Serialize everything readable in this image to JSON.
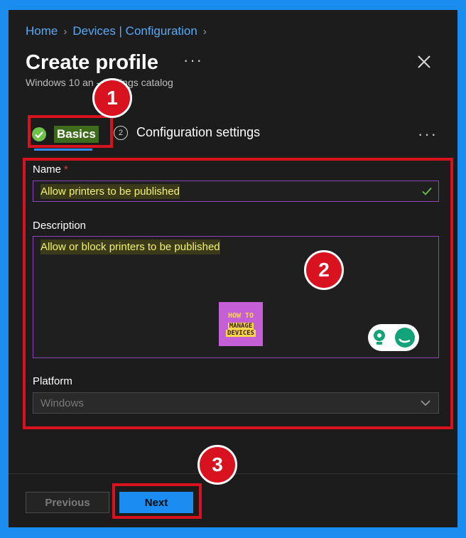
{
  "breadcrumb": {
    "home": "Home",
    "devices": "Devices | Configuration"
  },
  "page": {
    "title": "Create profile",
    "more": "···",
    "subtitle": "Windows 10 an        - Settings catalog"
  },
  "tabs": {
    "basics_label": "Basics",
    "config_step": "2",
    "config_label": "Configuration settings",
    "more": "···"
  },
  "form": {
    "name_label": "Name",
    "name_required": "*",
    "name_value": "Allow printers to be published",
    "description_label": "Description",
    "description_value": "Allow or block printers to be published",
    "platform_label": "Platform",
    "platform_value": "Windows"
  },
  "logo": {
    "line1": "HOW TO",
    "line2": "MANAGE",
    "line3": "DEVICES"
  },
  "annotations": {
    "badge1": "1",
    "badge2": "2",
    "badge3": "3",
    "color": "#d8131f"
  },
  "footer": {
    "previous_label": "Previous",
    "next_label": "Next"
  },
  "icons": {
    "close": "close-icon",
    "check": "check-circle-icon",
    "valid": "checkmark-icon",
    "chevron": "chevron-down-icon"
  },
  "colors": {
    "accent": "#1a8cf2",
    "success": "#6cc24a",
    "frame": "#1b8cf0"
  }
}
